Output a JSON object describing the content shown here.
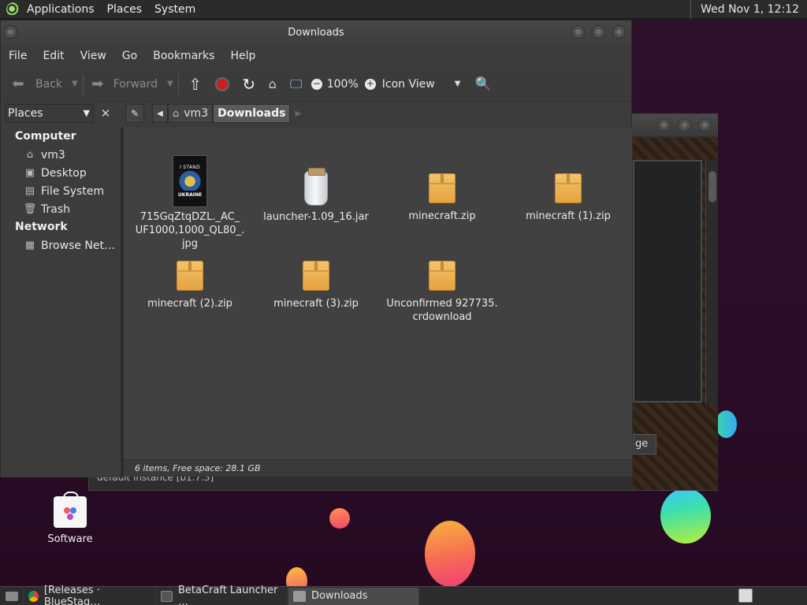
{
  "top_panel": {
    "menus": [
      "Applications",
      "Places",
      "System"
    ],
    "clock": "Wed Nov 1, 12:12"
  },
  "window": {
    "title": "Downloads",
    "menubar": [
      "File",
      "Edit",
      "View",
      "Go",
      "Bookmarks",
      "Help"
    ],
    "toolbar": {
      "back_label": "Back",
      "forward_label": "Forward",
      "zoom": "100%",
      "view_mode": "Icon View"
    },
    "sidebar": {
      "selector": "Places",
      "groups": [
        {
          "label": "Computer",
          "items": [
            {
              "label": "vm3",
              "icon": "home-folder-icon"
            },
            {
              "label": "Desktop",
              "icon": "desktop-folder-icon"
            },
            {
              "label": "File System",
              "icon": "drive-icon"
            },
            {
              "label": "Trash",
              "icon": "trash-icon"
            }
          ]
        },
        {
          "label": "Network",
          "items": [
            {
              "label": "Browse Net…",
              "icon": "network-icon"
            }
          ]
        }
      ]
    },
    "breadcrumb": {
      "items": [
        "vm3",
        "Downloads"
      ]
    },
    "files": [
      {
        "name": "715GqZtqDZL._AC_\nUF1000,1000_QL80_.\njpg",
        "type": "image",
        "thumb_top": "I STAND WITH",
        "thumb_bottom": "UKRAINE"
      },
      {
        "name": "launcher-1.09_16.jar",
        "type": "jar"
      },
      {
        "name": "minecraft.zip",
        "type": "archive"
      },
      {
        "name": "minecraft (1).zip",
        "type": "archive"
      },
      {
        "name": "minecraft (2).zip",
        "type": "archive"
      },
      {
        "name": "minecraft (3).zip",
        "type": "archive"
      },
      {
        "name": "Unconfirmed 927735.\ncrdownload",
        "type": "archive"
      }
    ],
    "status": "6 items, Free space: 28.1 GB"
  },
  "background_window": {
    "page_button": "ge",
    "status": "default instance [b1.7.3]"
  },
  "desktop_icons": [
    {
      "label": "Software",
      "icon": "software-store-icon"
    }
  ],
  "taskbar": {
    "tasks": [
      {
        "label": "[Releases · BlueStag…",
        "icon": "chrome-icon",
        "active": false
      },
      {
        "label": "BetaCraft Launcher …",
        "icon": "app-icon",
        "active": false
      },
      {
        "label": "Downloads",
        "icon": "folder-icon",
        "active": true
      }
    ]
  },
  "colors": {
    "desktop_bg": "#2a0d27",
    "window_bg": "#3c3c3c",
    "content_bg": "#414141",
    "stop_button": "#d12626"
  }
}
